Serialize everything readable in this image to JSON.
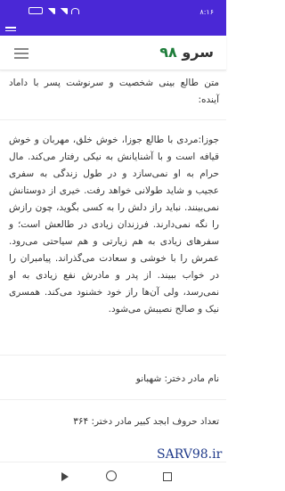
{
  "status_bar": {
    "time": "۸:۱۶",
    "background": "#4a28d6"
  },
  "header": {
    "logo_text": "سرو",
    "logo_number": "۹۸"
  },
  "content": {
    "intro": "متن طالع بینی شخصیت و سرنوشت پسر با داماد آینده:",
    "main": "جوزا:مردی با طالع جوزا، خوش خلق، مهربان و خوش قیافه است و با آشنایانش به نیکی رفتار می‌کند. مال حرام به او نمی‌سازد و در طول زندگی به سفری عجیب و شاید طولانی خواهد رفت. خیری از دوستانش نمی‌بینند. نباید راز دلش را به کسی بگوید، چون رازش را نگه نمی‌دارند. فرزندان زیادی در طالعش است؛ و سفرهای زیادی به هم زیارتی و هم سیاحتی می‌رود. عمرش را با خوشی و سعادت می‌گذراند. پیامبران را در خواب ببیند. از پدر و مادرش نفع زیادی به او نمی‌رسد، ولی آن‌ها راز خود خشنود می‌کند. همسری نیک و صالح نصیبش می‌شود.",
    "mother_name": "نام مادر دختر: شهبانو",
    "abjad": "تعداد حروف ابجد کبیر مادر دختر: ۳۶۴"
  },
  "watermark": "SARV98.ir",
  "icons": [
    "battery-icon",
    "signal-icon",
    "wifi-icon",
    "menu-icon",
    "hamburger-icon",
    "back-icon",
    "home-icon",
    "recent-apps-icon"
  ]
}
